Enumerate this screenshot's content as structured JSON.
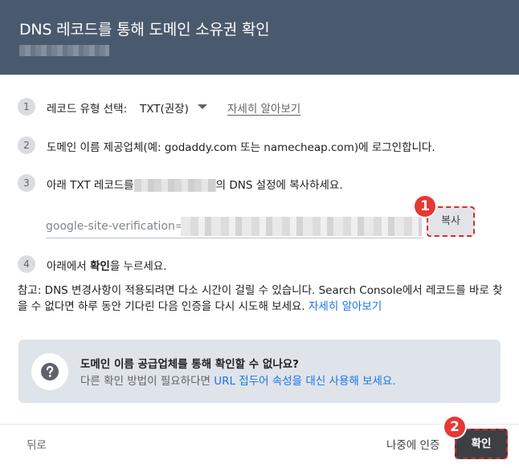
{
  "dialog": {
    "title": "DNS 레코드를 통해 도메인 소유권 확인"
  },
  "steps": [
    {
      "num": "1",
      "label": "레코드 유형 선택:",
      "select_value": "TXT(권장)",
      "link": "자세히 알아보기"
    },
    {
      "num": "2",
      "text": "도메인 이름 제공업체(예: godaddy.com 또는 namecheap.com)에 로그인합니다."
    },
    {
      "num": "3",
      "text_before": "아래 TXT 레코드를",
      "text_after": "의 DNS 설정에 복사하세요."
    },
    {
      "num": "4",
      "text_before": "아래에서 ",
      "text_bold": "확인",
      "text_after": "을 누르세요."
    }
  ],
  "record": {
    "prefix": "google-site-verification=",
    "copy_label": "복사"
  },
  "note": {
    "text": "참고: DNS 변경사항이 적용되려면 다소 시간이 걸릴 수 있습니다. Search Console에서 레코드를 바로 찾을 수 없다면 하루 동안 기다린 다음 인증을 다시 시도해 보세요.",
    "link": "자세히 알아보기"
  },
  "info_box": {
    "icon": "help-icon",
    "title": "도메인 이름 공급업체를 통해 확인할 수 없나요?",
    "desc_before": "다른 확인 방법이 필요하다면 ",
    "desc_link": "URL 접두어 속성을 대신 사용해 보세요."
  },
  "footer": {
    "back_label": "뒤로",
    "later_label": "나중에 인증",
    "confirm_label": "확인"
  },
  "callouts": [
    "1",
    "2"
  ],
  "colors": {
    "header_bg": "#4a5a6e",
    "link": "#1a73e8",
    "callout": "#e53935",
    "confirm_bg": "#3c4043"
  }
}
